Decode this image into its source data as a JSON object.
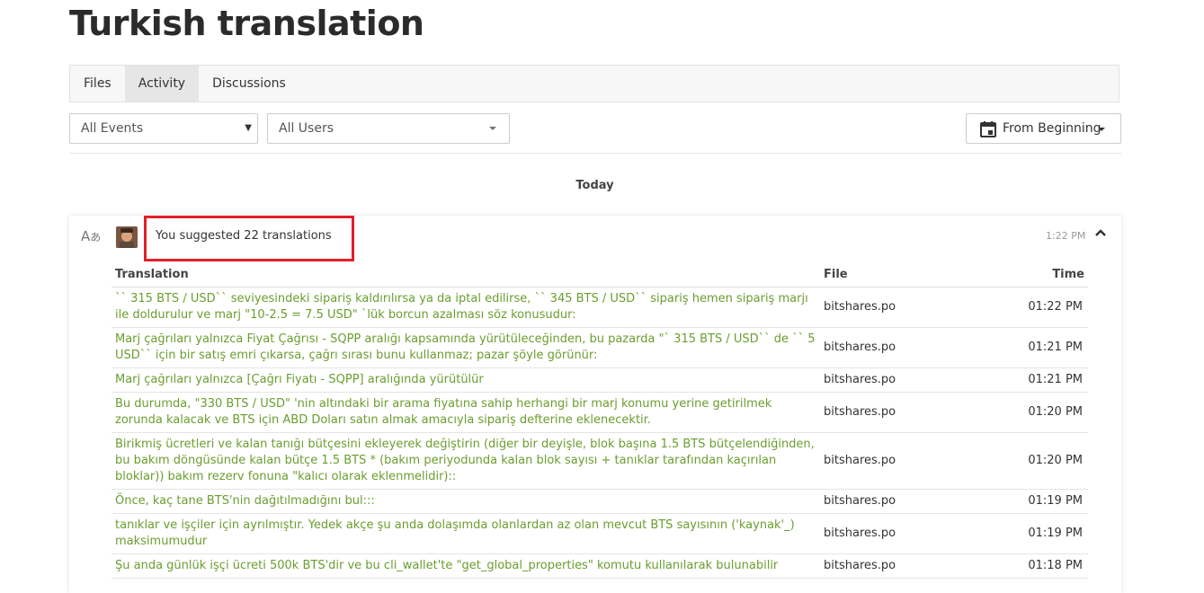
{
  "page": {
    "title": "Turkish translation"
  },
  "tabs": [
    {
      "label": "Files",
      "active": false
    },
    {
      "label": "Activity",
      "active": true
    },
    {
      "label": "Discussions",
      "active": false
    }
  ],
  "filters": {
    "events": "All Events",
    "users": "All Users",
    "date": "From Beginning"
  },
  "section_label": "Today",
  "activity": {
    "summary": "You suggested 22 translations",
    "time": "1:22 PM",
    "columns": {
      "translation": "Translation",
      "file": "File",
      "time": "Time"
    },
    "rows": [
      {
        "translation": "`` 315 BTS / USD`` seviyesindeki sipariş kaldırılırsa ya da iptal edilirse, `` 345 BTS / USD`` sipariş hemen sipariş marjı ile doldurulur ve marj \"10-2.5 = 7.5 USD\" `lük borcun azalması söz konusudur:",
        "file": "bitshares.po",
        "time": "01:22 PM"
      },
      {
        "translation": "Marj çağrıları yalnızca Fiyat Çağrısı - SQPP aralığı kapsamında yürütüleceğinden, bu pazarda \"` 315 BTS / USD`` de `` 5 USD`` için bir satış emri çıkarsa, çağrı sırası bunu kullanmaz; pazar şöyle görünür:",
        "file": "bitshares.po",
        "time": "01:21 PM"
      },
      {
        "translation": "Marj çağrıları yalnızca [Çağrı Fiyatı - SQPP] aralığında yürütülür",
        "file": "bitshares.po",
        "time": "01:21 PM"
      },
      {
        "translation": "Bu durumda, \"330 BTS / USD\" 'nin altındaki bir arama fiyatına sahip herhangi bir marj konumu yerine getirilmek zorunda kalacak ve BTS için ABD Doları satın almak amacıyla sipariş defterine eklenecektir.",
        "file": "bitshares.po",
        "time": "01:20 PM"
      },
      {
        "translation": "Birikmiş ücretleri ve kalan tanığı bütçesini ekleyerek değiştirin (diğer bir deyişle, blok başına 1.5 BTS bütçelendiğinden, bu bakım döngüsünde kalan bütçe 1.5 BTS * (bakım periyodunda kalan blok sayısı + tanıklar tarafından kaçırılan bloklar)) bakım rezerv fonuna \"kalıcı olarak eklenmelidir)::",
        "file": "bitshares.po",
        "time": "01:20 PM"
      },
      {
        "translation": "Önce, kaç tane BTS'nin dağıtılmadığını bul:::",
        "file": "bitshares.po",
        "time": "01:19 PM"
      },
      {
        "translation": "tanıklar ve işçiler için ayrılmıştır. Yedek akçe şu anda dolaşımda olanlardan az olan mevcut BTS sayısının ('kaynak'_) maksimumudur",
        "file": "bitshares.po",
        "time": "01:19 PM"
      },
      {
        "translation": "Şu anda günlük işçi ücreti 500k BTS'dir ve bu cli_wallet'te \"get_global_properties\" komutu kullanılarak bulunabilir",
        "file": "bitshares.po",
        "time": "01:18 PM"
      }
    ]
  }
}
